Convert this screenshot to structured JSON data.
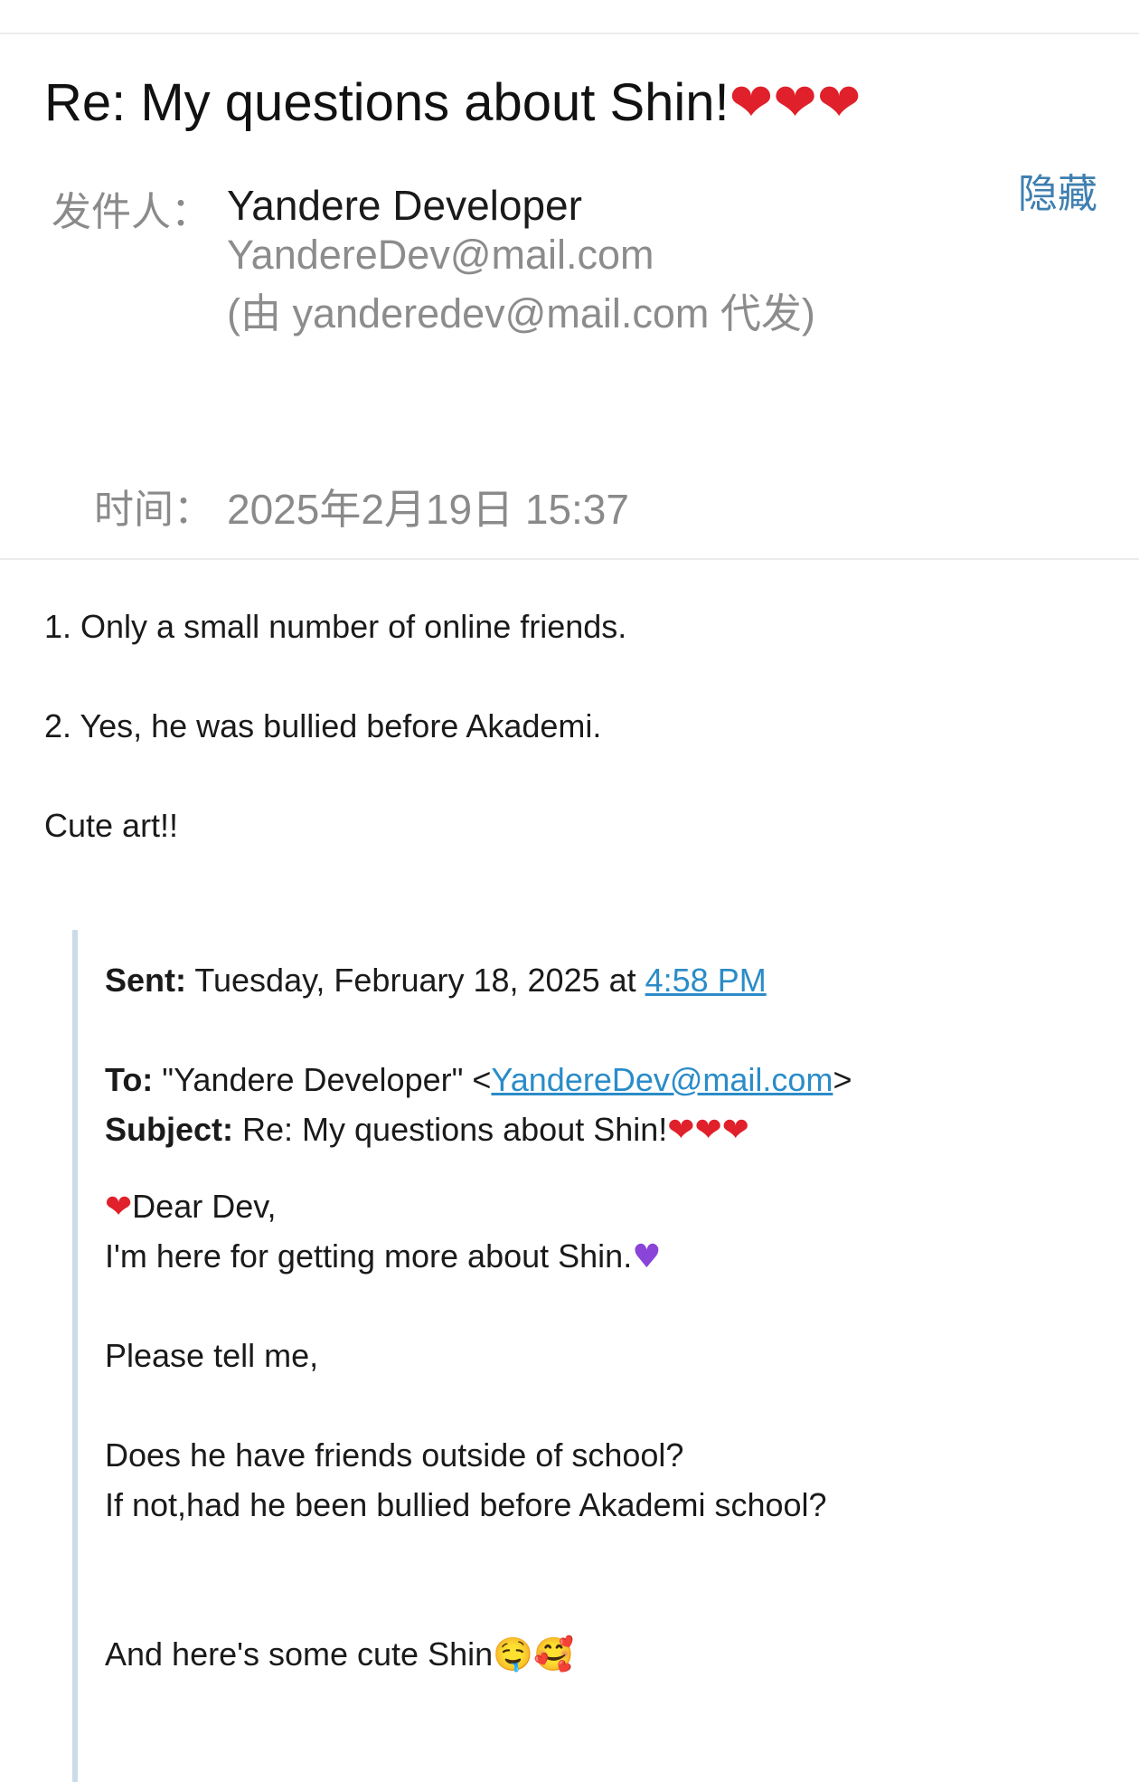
{
  "email": {
    "subject": "Re: My questions about Shin!",
    "subject_hearts": [
      "❤️",
      "❤️",
      "❤️"
    ],
    "sender_label": "发件人：",
    "sender_name": "Yandere Developer",
    "sender_email": "YandereDev@mail.com",
    "sent_on_behalf": "(由 yanderedev@mail.com 代发)",
    "hide_label": "隐藏",
    "time_label": "时间：",
    "time_value": "2025年2月19日 15:37"
  },
  "body": {
    "line1": "1. Only a small number of online friends.",
    "line2": "2. Yes, he was bullied before Akademi.",
    "line3": "Cute art!!"
  },
  "quoted": {
    "sent_label": "Sent:",
    "sent_text": " Tuesday, February 18, 2025 at ",
    "sent_time_link": "4:58 PM",
    "to_label": "To:",
    "to_text": " \"Yandere Developer\" <",
    "to_email_link": "YandereDev@mail.com",
    "to_close": ">",
    "subject_label": "Subject:",
    "subject_text": " Re: My questions about Shin!",
    "subject_hearts": "❤❤❤",
    "greeting_heart": "❤",
    "greeting": "Dear Dev,",
    "line_here": "I'm here for getting more about Shin.",
    "purple_heart": "♥",
    "please": "Please tell me,",
    "question1": "Does he have friends outside of school?",
    "question2": "If not,had he been bullied before Akademi school?",
    "closing": "And here's some cute Shin",
    "closing_emojis": "🤤🥰"
  }
}
